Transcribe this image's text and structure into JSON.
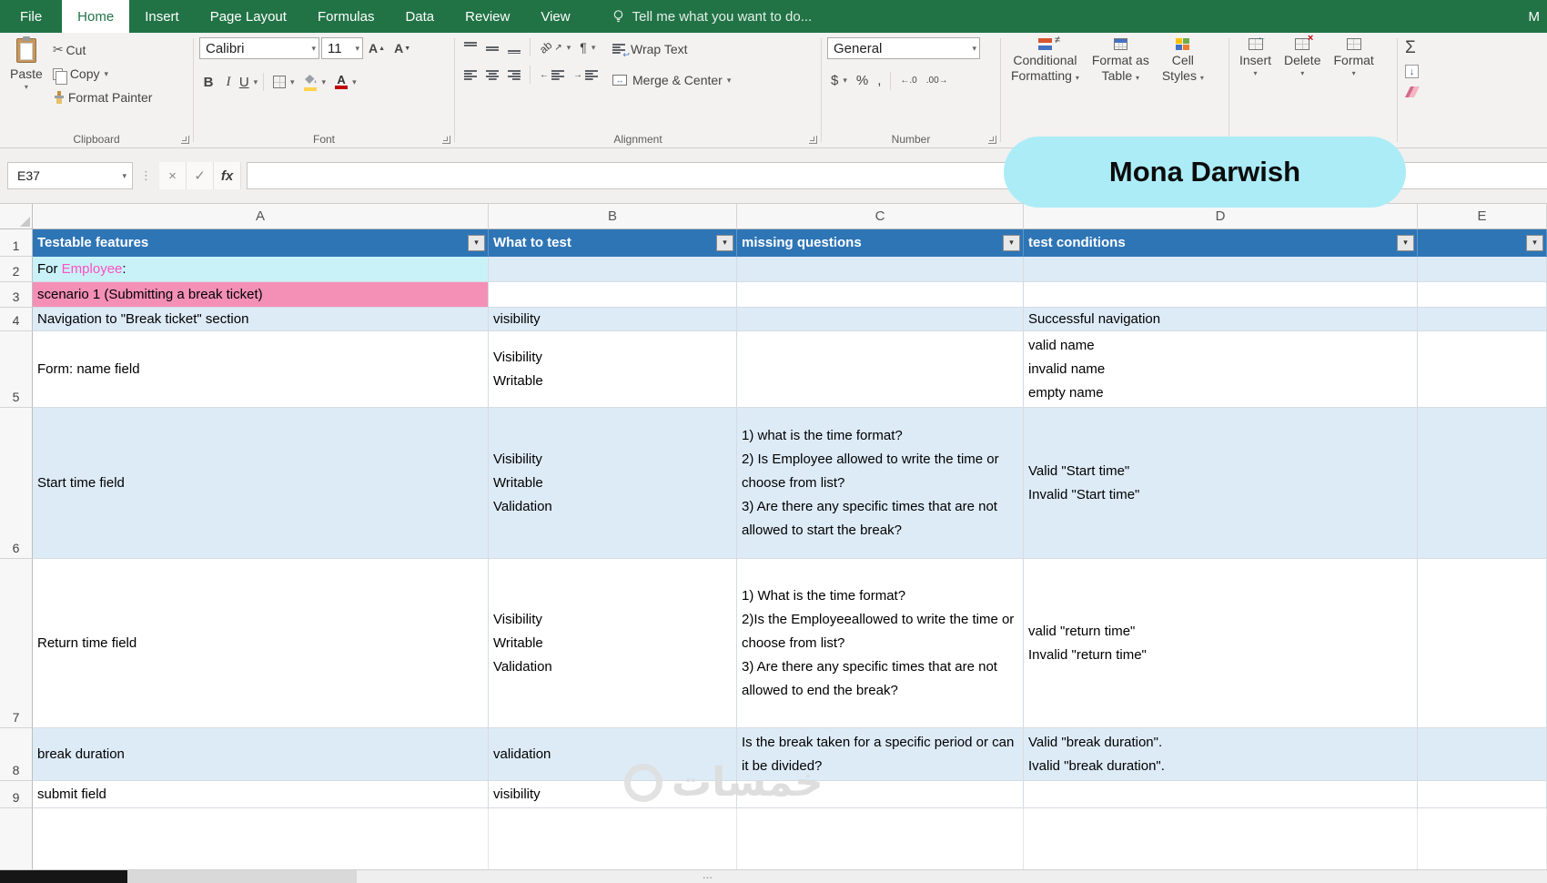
{
  "colors": {
    "excel_green": "#217346",
    "table_header_blue": "#2E75B6",
    "band_blue": "#DDEBF7",
    "row2_cyan": "#C9F2F8",
    "row3_pink": "#F48FB6",
    "employee_text_pink": "#FF4FC3",
    "overlay_cyan": "#ABECF7"
  },
  "titlebar": {
    "account_initial": "M"
  },
  "menu": {
    "tabs": [
      {
        "label": "File"
      },
      {
        "label": "Home"
      },
      {
        "label": "Insert"
      },
      {
        "label": "Page Layout"
      },
      {
        "label": "Formulas"
      },
      {
        "label": "Data"
      },
      {
        "label": "Review"
      },
      {
        "label": "View"
      }
    ],
    "tell_me": "Tell me what you want to do..."
  },
  "ribbon": {
    "clipboard": {
      "label": "Clipboard",
      "paste": "Paste",
      "cut": "Cut",
      "copy": "Copy",
      "format_painter": "Format Painter"
    },
    "font": {
      "label": "Font",
      "name": "Calibri",
      "size": "11",
      "bold": "B",
      "italic": "I",
      "underline": "U"
    },
    "alignment": {
      "label": "Alignment",
      "wrap": "Wrap Text",
      "merge": "Merge & Center"
    },
    "number": {
      "label": "Number",
      "format": "General"
    },
    "styles": {
      "conditional_line1": "Conditional",
      "conditional_line2": "Formatting",
      "table_line1": "Format as",
      "table_line2": "Table",
      "cellstyles_line1": "Cell",
      "cellstyles_line2": "Styles"
    },
    "cells": {
      "insert": "Insert",
      "delete": "Delete",
      "format": "Format"
    }
  },
  "icons": {
    "dropdown": "▾",
    "scissors": "✂",
    "check": "✓",
    "cross": "×",
    "dots": "⋮",
    "sigma": "Σ",
    "dollar": "$",
    "percent": "%",
    "comma": ",",
    "paragraph": "¶",
    "ab": "ab",
    "arrow_ne": "↗",
    "increase_decimal": "←.0",
    "decrease_decimal": ".00→",
    "fill_down": "↓",
    "wrap_return": "↩",
    "merge_arrows": "↔",
    "outdent": "←",
    "indent": "→",
    "not_equal": "≠",
    "font_A": "A",
    "tri_up": "▲",
    "tri_down": "▼"
  },
  "formula_bar": {
    "name_box": "E37",
    "fx_label": "fx",
    "formula": ""
  },
  "overlay_badge": {
    "text": "Mona Darwish"
  },
  "watermark": {
    "text": "خمسات"
  },
  "bottom_bar": {
    "dots": "..."
  },
  "sheet": {
    "column_headers": [
      "A",
      "B",
      "C",
      "D",
      "E"
    ],
    "row_headers": [
      "1",
      "2",
      "3",
      "4",
      "5",
      "6",
      "7",
      "8",
      "9"
    ],
    "header_row": {
      "a": "Testable features",
      "b": "What to test",
      "c": "missing questions",
      "d": "test conditions"
    },
    "r2": {
      "pre": "For ",
      "highlight": "Employee",
      "post": ":"
    },
    "r3": {
      "a": "scenario 1 (Submitting a break ticket)"
    },
    "r4": {
      "a": "Navigation to \"Break ticket\" section",
      "b": "visibility",
      "d": "Successful navigation"
    },
    "r5": {
      "a": "Form: name field",
      "b": [
        "Visibility",
        "Writable"
      ],
      "d": [
        "valid name",
        "invalid name",
        "empty name"
      ]
    },
    "r6": {
      "a": "Start time field",
      "b": [
        "Visibility",
        "Writable",
        "Validation"
      ],
      "c": [
        "1) what is the  time format?",
        "2) Is Employee allowed to write the time or choose from list?",
        "3) Are there any specific times that are  not allowed to start the break?"
      ],
      "d": [
        "Valid \"Start time\"",
        "Invalid \"Start time\""
      ]
    },
    "r7": {
      "a": "Return time field",
      "b": [
        "Visibility",
        "Writable",
        "Validation"
      ],
      "c": [
        "1) What is the time format?",
        "2)Is the Employeeallowed to write the time or choose from list?",
        "3) Are there any specific times that are  not allowed to end the break?"
      ],
      "d": [
        "valid \"return time\"",
        "Invalid \"return time\""
      ]
    },
    "r8": {
      "a": "break duration",
      "b": "validation",
      "c": "Is the break taken for a specific period or can it be divided?",
      "d": [
        "Valid  \"break duration\".",
        "Ivalid \"break duration\"."
      ]
    },
    "r9": {
      "a": "submit field",
      "b": "visibility"
    }
  }
}
